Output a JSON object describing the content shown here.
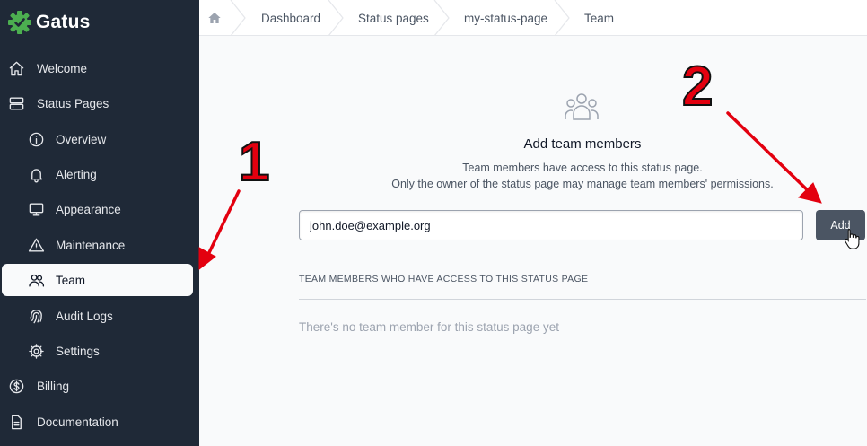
{
  "app": {
    "name": "Gatus"
  },
  "sidebar": {
    "items": [
      {
        "label": "Welcome",
        "icon": "home-icon"
      },
      {
        "label": "Status Pages",
        "icon": "server-icon"
      },
      {
        "label": "Overview",
        "icon": "info-icon"
      },
      {
        "label": "Alerting",
        "icon": "bell-icon"
      },
      {
        "label": "Appearance",
        "icon": "monitor-icon"
      },
      {
        "label": "Maintenance",
        "icon": "warning-icon"
      },
      {
        "label": "Team",
        "icon": "users-icon",
        "active": true
      },
      {
        "label": "Audit Logs",
        "icon": "fingerprint-icon"
      },
      {
        "label": "Settings",
        "icon": "gear-icon"
      },
      {
        "label": "Billing",
        "icon": "dollar-icon"
      },
      {
        "label": "Documentation",
        "icon": "document-icon"
      }
    ]
  },
  "breadcrumb": [
    "Dashboard",
    "Status pages",
    "my-status-page",
    "Team"
  ],
  "main": {
    "heading": "Add team members",
    "description_line1": "Team members have access to this status page.",
    "description_line2": "Only the owner of the status page may manage team members' permissions.",
    "email_value": "john.doe@example.org",
    "add_label": "Add",
    "members_header": "TEAM MEMBERS WHO HAVE ACCESS TO THIS STATUS PAGE",
    "empty_message": "There's no team member for this status page yet"
  },
  "annotations": {
    "step1": "1",
    "step2": "2"
  },
  "colors": {
    "sidebar_bg": "#1f2937",
    "brand_green": "#4caf50",
    "annotation_red": "#e3000f",
    "add_button": "#4b5563"
  }
}
